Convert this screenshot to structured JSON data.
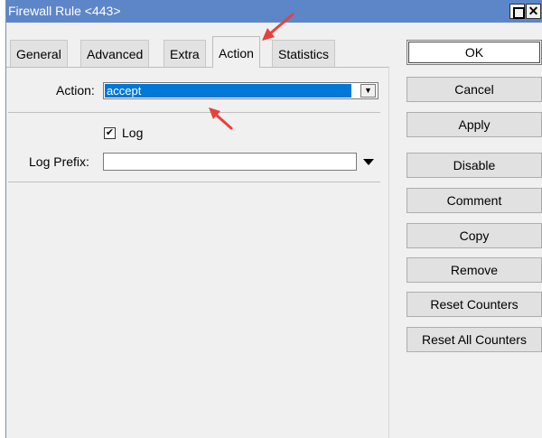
{
  "window": {
    "title": "Firewall Rule <443>",
    "close_glyph": "✕"
  },
  "tabs": [
    {
      "label": "General",
      "active": false
    },
    {
      "label": "Advanced",
      "active": false
    },
    {
      "label": "Extra",
      "active": false
    },
    {
      "label": "Action",
      "active": true
    },
    {
      "label": "Statistics",
      "active": false
    }
  ],
  "form": {
    "action_label": "Action:",
    "action_value": "accept",
    "dropdown_glyph": "▼",
    "log_label": "Log",
    "log_checked": true,
    "log_check_glyph": "✔",
    "log_prefix_label": "Log Prefix:",
    "log_prefix_value": ""
  },
  "buttons": [
    "OK",
    "Cancel",
    "Apply",
    "Disable",
    "Comment",
    "Copy",
    "Remove",
    "Reset Counters",
    "Reset All Counters"
  ],
  "colors": {
    "titlebar": "#5d86c9",
    "selection": "#0078d7",
    "annotation_arrow": "#e8413c"
  }
}
